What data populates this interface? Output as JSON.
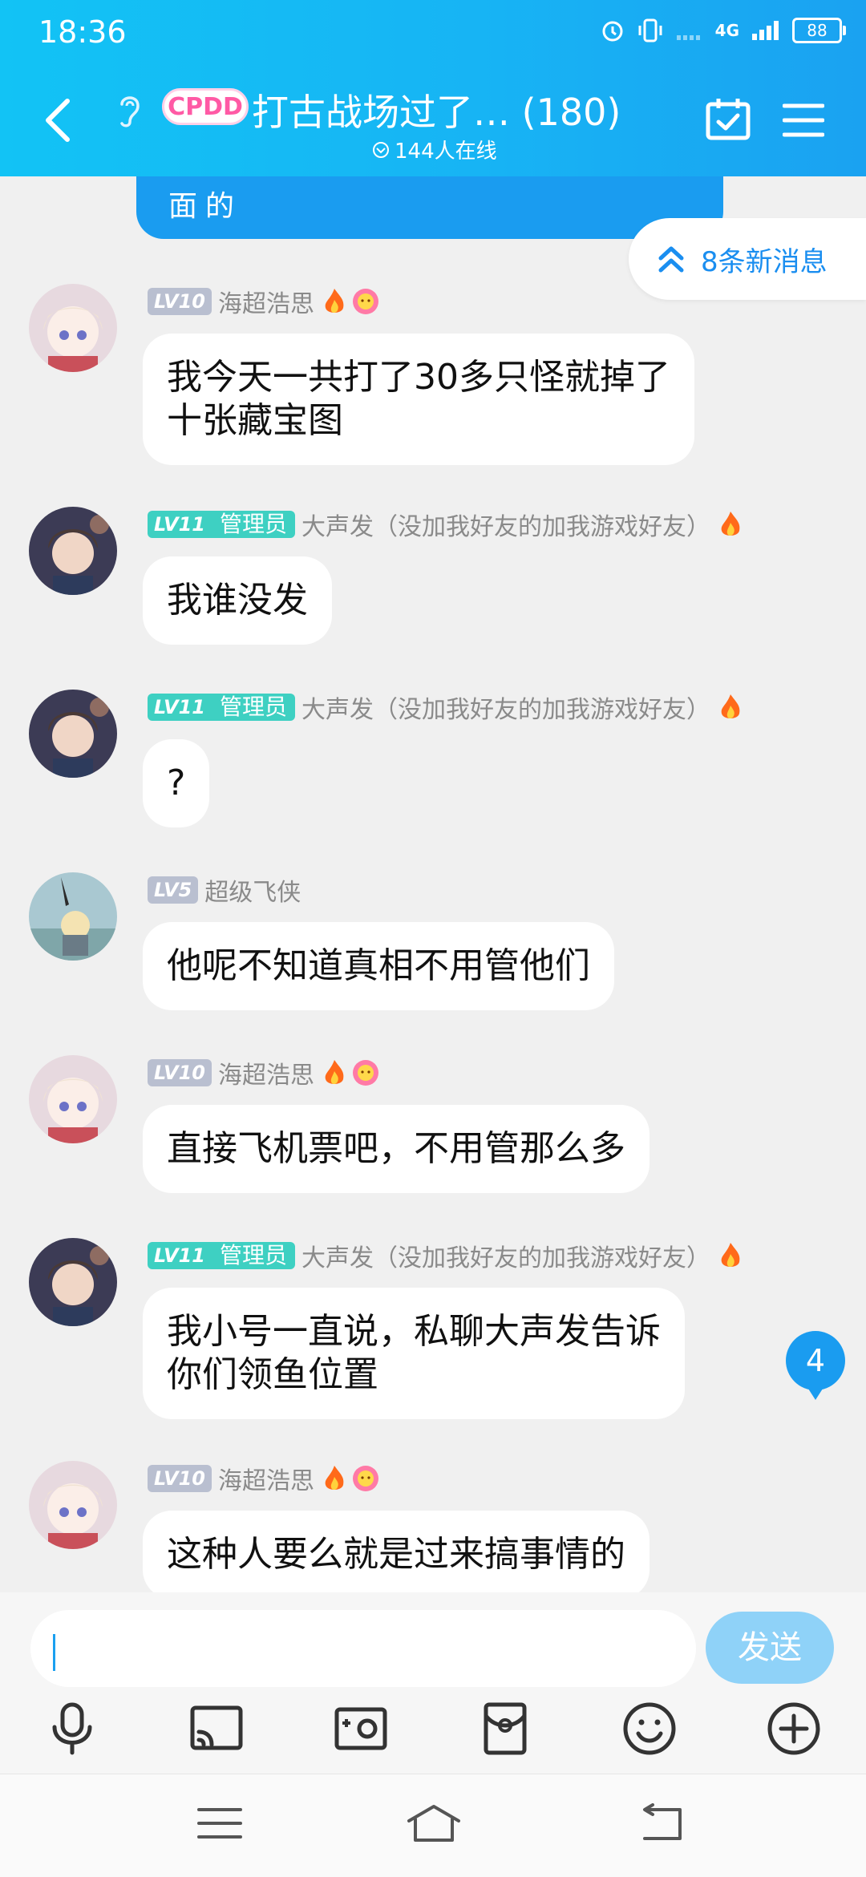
{
  "status": {
    "time": "18:36",
    "network": "4G",
    "battery": "88"
  },
  "header": {
    "badge": "CPDD",
    "title": "打古战场过了…  (180)",
    "online": "144人在线"
  },
  "chat": {
    "prev_bubble_text": "面的",
    "new_messages": "8条新消息",
    "messages": [
      {
        "level": "LV10",
        "role": "",
        "nick": "海超浩思",
        "text": "我今天一共打了30多只怪就掉了\n十张藏宝图"
      },
      {
        "level": "LV11",
        "role": "管理员",
        "nick": "大声发（没加我好友的加我游戏好友）",
        "text": "我谁没发"
      },
      {
        "level": "LV11",
        "role": "管理员",
        "nick": "大声发（没加我好友的加我游戏好友）",
        "text": "?"
      },
      {
        "level": "LV5",
        "role": "",
        "nick": "超级飞侠",
        "text": "他呢不知道真相不用管他们"
      },
      {
        "level": "LV10",
        "role": "",
        "nick": "海超浩思",
        "text": "直接飞机票吧，不用管那么多"
      },
      {
        "level": "LV11",
        "role": "管理员",
        "nick": "大声发（没加我好友的加我游戏好友）",
        "text": "我小号一直说，私聊大声发告诉\n你们领鱼位置"
      },
      {
        "level": "LV10",
        "role": "",
        "nick": "海超浩思",
        "text": "这种人要么就是过来搞事情的"
      }
    ],
    "unread_count": "4"
  },
  "input": {
    "value": "",
    "send_label": "发送"
  },
  "icons": {
    "tools": [
      "microphone-icon",
      "screen-cast-icon",
      "photo-icon",
      "red-packet-icon",
      "emoji-icon",
      "plus-icon"
    ],
    "nav": [
      "menu-icon",
      "home-icon",
      "back-icon"
    ]
  },
  "colors": {
    "header": "#17b4f4",
    "accent": "#1a9cf0",
    "admin_tag": "#3ed0c2",
    "level_tag": "#b9bfd0"
  }
}
